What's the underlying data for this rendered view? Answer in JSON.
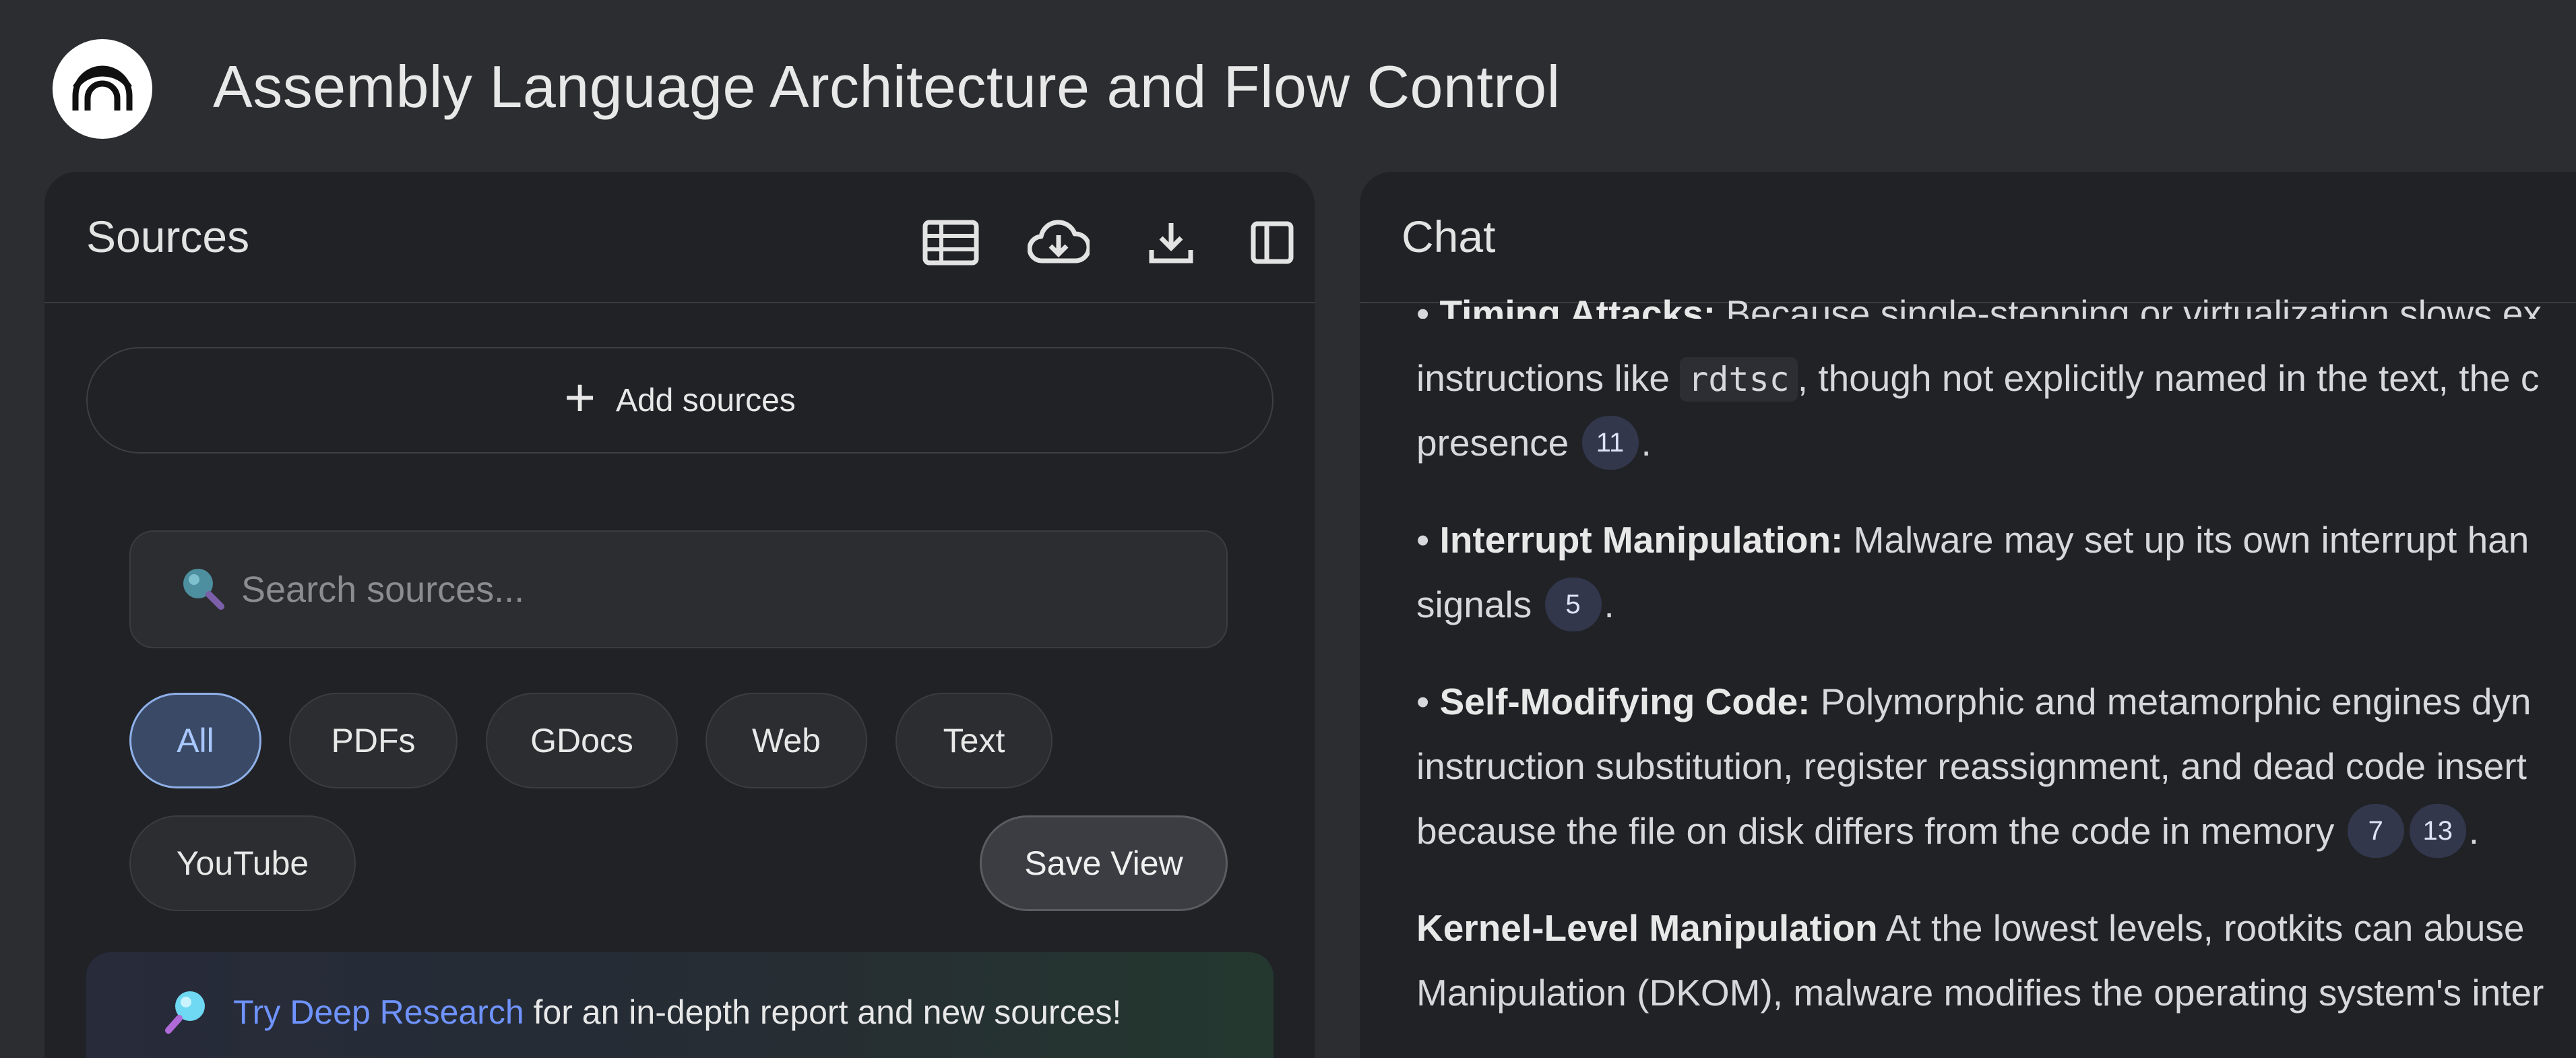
{
  "app": {
    "title": "Assembly Language Architecture and Flow Control",
    "logo_icon": "notebook-logo-icon"
  },
  "sources": {
    "title": "Sources",
    "header_icons": [
      "table-icon",
      "cloud-download-icon",
      "download-icon",
      "sidebar-collapse-icon"
    ],
    "add_sources_label": "Add sources",
    "search": {
      "placeholder": "Search sources...",
      "value": ""
    },
    "filters": [
      {
        "label": "All",
        "active": true
      },
      {
        "label": "PDFs",
        "active": false
      },
      {
        "label": "GDocs",
        "active": false
      },
      {
        "label": "Web",
        "active": false
      },
      {
        "label": "Text",
        "active": false
      },
      {
        "label": "YouTube",
        "active": false
      }
    ],
    "save_view_label": "Save View",
    "deep_research": {
      "link": "Try Deep Research",
      "text": " for an in-depth report and new sources!"
    }
  },
  "chat": {
    "title": "Chat",
    "clipped_line": {
      "bullet": "•",
      "bold": "Timing Attacks:",
      "text": " Because single-stepping or virtualization slows ex"
    },
    "timing_line2_pre": "instructions like ",
    "timing_code": "rdtsc",
    "timing_line2_post": ", though not explicitly named in the text, the c",
    "timing_line3": "presence",
    "timing_cite": "11",
    "interrupt": {
      "bullet": "•",
      "bold": "Interrupt Manipulation:",
      "line1": " Malware may set up its own interrupt han",
      "line2": "signals",
      "cite": "5"
    },
    "selfmod": {
      "bullet": "•",
      "bold": "Self-Modifying Code:",
      "line1": " Polymorphic and metamorphic engines dyn",
      "line2": "instruction substitution, register reassignment, and dead code insert",
      "line3": "because the file on disk differs from the code in memory",
      "cite1": "7",
      "cite2": "13"
    },
    "kernel": {
      "bold": "Kernel-Level Manipulation",
      "line1": " At the lowest levels, rootkits can abuse",
      "line2": "Manipulation (DKOM), malware modifies the operating system's inter"
    },
    "period": "."
  }
}
